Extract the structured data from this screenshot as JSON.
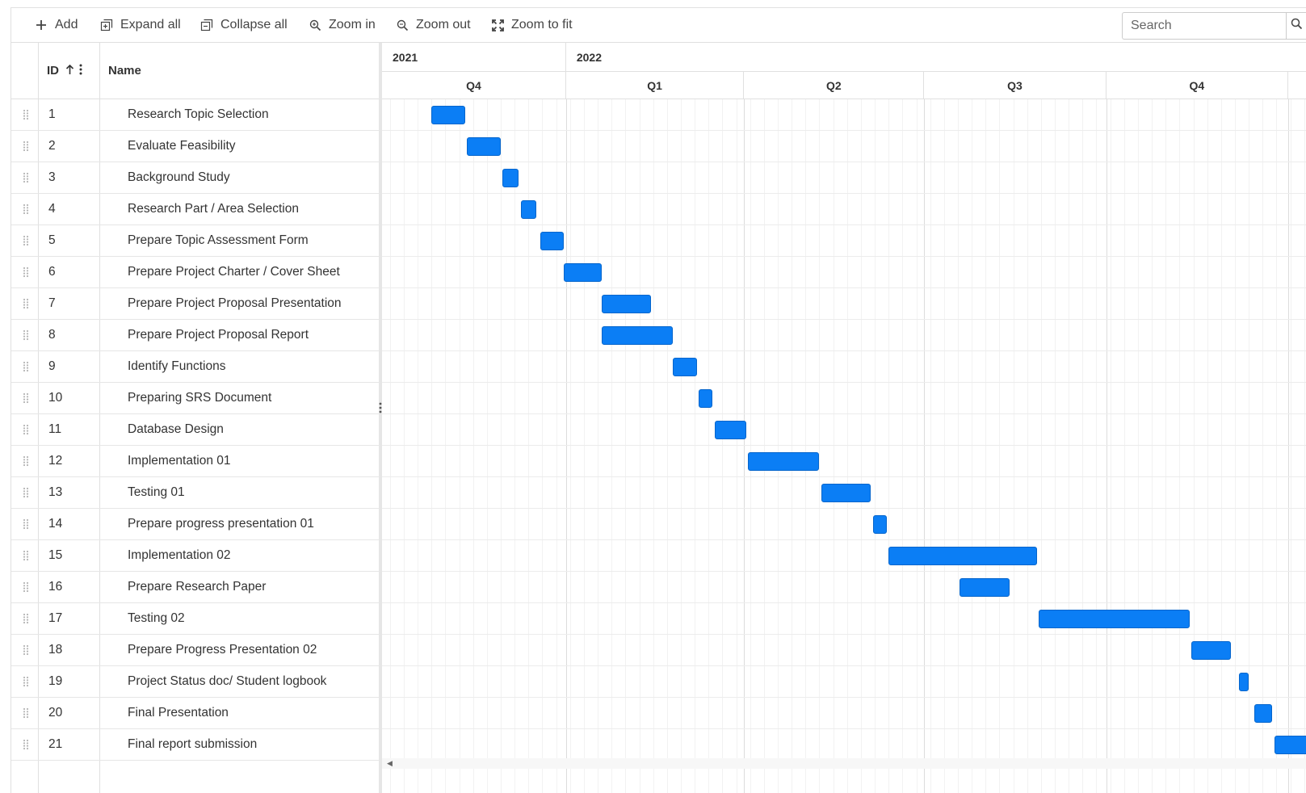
{
  "toolbar": {
    "add_label": "Add",
    "expand_label": "Expand all",
    "collapse_label": "Collapse all",
    "zoom_in_label": "Zoom in",
    "zoom_out_label": "Zoom out",
    "zoom_fit_label": "Zoom to fit",
    "search_placeholder": "Search"
  },
  "grid": {
    "columns": {
      "id": "ID",
      "name": "Name"
    },
    "sort": "ascending"
  },
  "timeline": {
    "years": [
      "2021",
      "2022"
    ],
    "quarters": [
      "Q4",
      "Q1",
      "Q2",
      "Q3",
      "Q4"
    ]
  },
  "colors": {
    "bar": "#0b7ef5",
    "bar_border": "#0565cc"
  },
  "tasks": [
    {
      "id": "1",
      "name": "Research Topic Selection",
      "start": "2021-10-25",
      "end": "2021-11-11"
    },
    {
      "id": "2",
      "name": "Evaluate Feasibility",
      "start": "2021-11-12",
      "end": "2021-11-29"
    },
    {
      "id": "3",
      "name": "Background Study",
      "start": "2021-11-30",
      "end": "2021-12-08"
    },
    {
      "id": "4",
      "name": "Research Part / Area Selection",
      "start": "2021-12-09",
      "end": "2021-12-17"
    },
    {
      "id": "5",
      "name": "Prepare Topic Assessment Form",
      "start": "2021-12-19",
      "end": "2021-12-31"
    },
    {
      "id": "6",
      "name": "Prepare Project Charter / Cover Sheet",
      "start": "2021-12-31",
      "end": "2022-01-19"
    },
    {
      "id": "7",
      "name": "Prepare Project Proposal Presentation",
      "start": "2022-01-19",
      "end": "2022-02-13"
    },
    {
      "id": "8",
      "name": "Prepare Project Proposal Report",
      "start": "2022-01-19",
      "end": "2022-02-24"
    },
    {
      "id": "9",
      "name": "Identify Functions",
      "start": "2022-02-24",
      "end": "2022-03-08"
    },
    {
      "id": "10",
      "name": "Preparing SRS Document",
      "start": "2022-03-09",
      "end": "2022-03-16"
    },
    {
      "id": "11",
      "name": "Database Design",
      "start": "2022-03-17",
      "end": "2022-04-02"
    },
    {
      "id": "12",
      "name": "Implementation 01",
      "start": "2022-04-03",
      "end": "2022-05-09"
    },
    {
      "id": "13",
      "name": "Testing 01",
      "start": "2022-05-10",
      "end": "2022-06-04"
    },
    {
      "id": "14",
      "name": "Prepare progress presentation 01",
      "start": "2022-06-05",
      "end": "2022-06-12"
    },
    {
      "id": "15",
      "name": "Implementation 02",
      "start": "2022-06-13",
      "end": "2022-08-27"
    },
    {
      "id": "16",
      "name": "Prepare Research Paper",
      "start": "2022-07-19",
      "end": "2022-08-13"
    },
    {
      "id": "17",
      "name": "Testing 02",
      "start": "2022-08-28",
      "end": "2022-11-12"
    },
    {
      "id": "18",
      "name": "Prepare Progress Presentation 02",
      "start": "2022-11-13",
      "end": "2022-12-03"
    },
    {
      "id": "19",
      "name": "Project Status doc/ Student logbook",
      "start": "2022-12-07",
      "end": "2022-12-12"
    },
    {
      "id": "20",
      "name": "Final Presentation",
      "start": "2022-12-15",
      "end": "2022-12-24"
    },
    {
      "id": "21",
      "name": "Final report submission",
      "start": "2022-12-25",
      "end": "2023-02-19"
    }
  ]
}
